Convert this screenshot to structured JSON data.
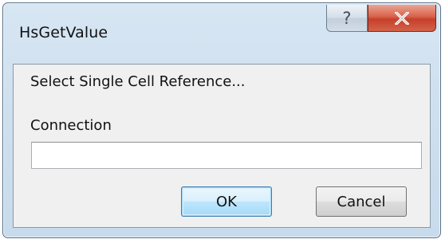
{
  "window": {
    "title": "HsGetValue",
    "help_button": "?",
    "close_button": "x"
  },
  "dialog": {
    "prompt": "Select Single Cell Reference...",
    "connection_label": "Connection",
    "connection_value": ""
  },
  "buttons": {
    "ok_label": "OK",
    "cancel_label": "Cancel"
  },
  "colors": {
    "frame": "#c8dbec",
    "client": "#f0f0f0",
    "close_red": "#c6402a",
    "default_button_border": "#3c7fb1"
  }
}
